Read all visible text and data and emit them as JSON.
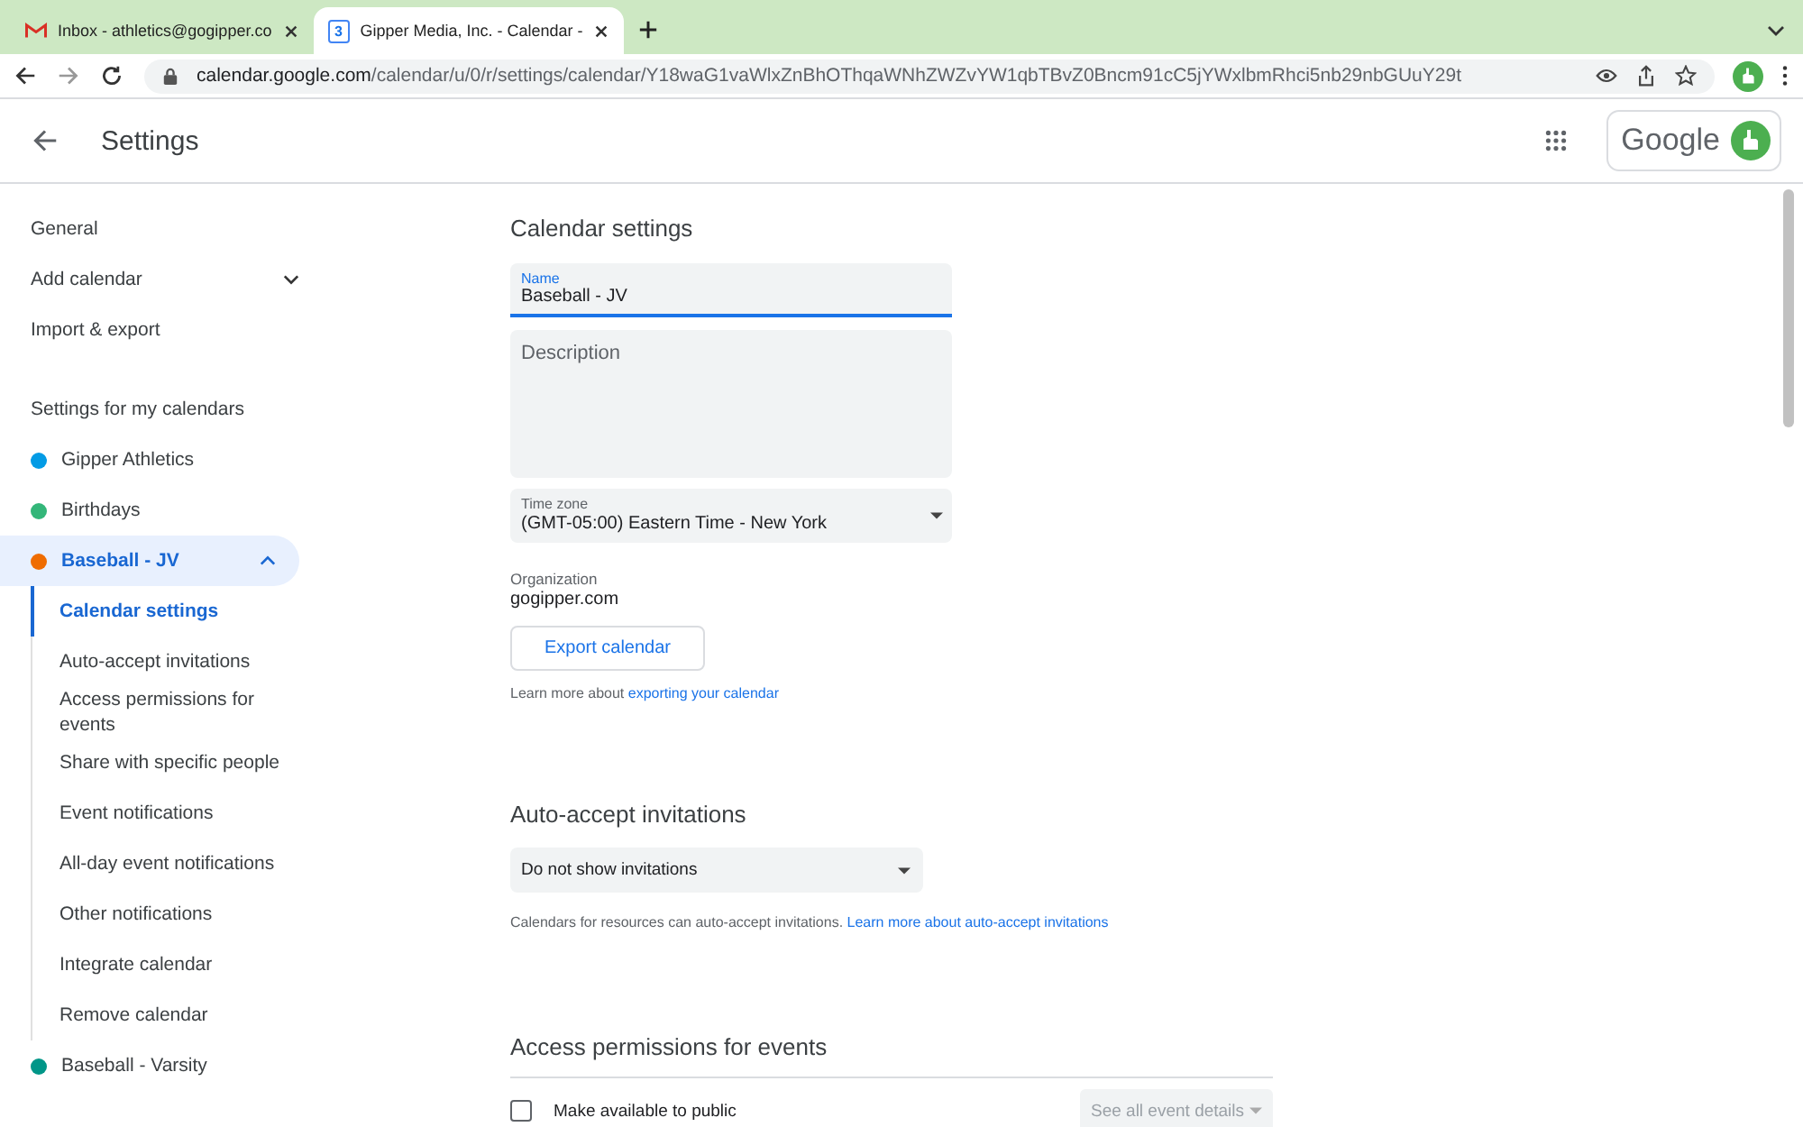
{
  "browser": {
    "tabs": [
      {
        "title": "Inbox - athletics@gogipper.co",
        "selected": false
      },
      {
        "title": "Gipper Media, Inc. - Calendar -",
        "selected": true
      }
    ],
    "calendar_icon_day": "3",
    "url_host": "calendar.google.com",
    "url_path": "/calendar/u/0/r/settings/calendar/Y18waG1vaWlxZnBhOThqaWNhZWZvYW1qbTBvZ0Bncm91cC5jYWxlbmRhci5nb29nbGUuY29t"
  },
  "header": {
    "title": "Settings",
    "account_label": "Google"
  },
  "sidebar": {
    "items": [
      {
        "label": "General",
        "kind": "link"
      },
      {
        "label": "Add calendar",
        "kind": "expandable",
        "expanded": false
      },
      {
        "label": "Import & export",
        "kind": "link"
      }
    ],
    "section_title": "Settings for my calendars",
    "calendars": [
      {
        "name": "Gipper Athletics",
        "color": "#039be5",
        "selected": false
      },
      {
        "name": "Birthdays",
        "color": "#33b679",
        "selected": false
      },
      {
        "name": "Baseball - JV",
        "color": "#ef6c00",
        "selected": true,
        "expanded": true,
        "children": [
          {
            "label": "Calendar settings",
            "selected": true
          },
          {
            "label": "Auto-accept invitations",
            "selected": false
          },
          {
            "label": "Access permissions for events",
            "selected": false
          },
          {
            "label": "Share with specific people",
            "selected": false
          },
          {
            "label": "Event notifications",
            "selected": false
          },
          {
            "label": "All-day event notifications",
            "selected": false
          },
          {
            "label": "Other notifications",
            "selected": false
          },
          {
            "label": "Integrate calendar",
            "selected": false
          },
          {
            "label": "Remove calendar",
            "selected": false
          }
        ]
      },
      {
        "name": "Baseball - Varsity",
        "color": "#009688",
        "selected": false
      }
    ]
  },
  "calendar_settings": {
    "heading": "Calendar settings",
    "name_field": {
      "label": "Name",
      "value": "Baseball - JV",
      "focused": true
    },
    "description_field": {
      "placeholder": "Description"
    },
    "time_zone": {
      "label": "Time zone",
      "value": "(GMT-05:00) Eastern Time - New York"
    },
    "organization": {
      "label": "Organization",
      "value": "gogipper.com"
    },
    "export_button": "Export calendar",
    "learn_more": {
      "text": "Learn more about",
      "link": "exporting your calendar"
    }
  },
  "auto_accept": {
    "heading": "Auto-accept invitations",
    "select": "Do not show invitations",
    "note": "Calendars for resources can auto-accept invitations.",
    "link": "Learn more about auto-accept invitations"
  },
  "access_permissions": {
    "heading": "Access permissions for events",
    "checkbox": {
      "label": "Make available to public",
      "checked": false
    },
    "select": {
      "value": "See all event details",
      "disabled": true
    }
  }
}
